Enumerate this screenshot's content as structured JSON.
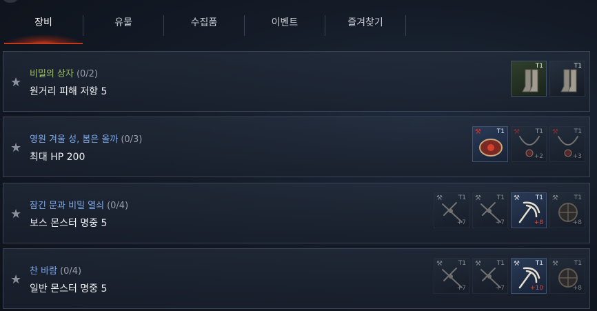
{
  "tabs": [
    {
      "label": "장비",
      "active": true
    },
    {
      "label": "유물",
      "active": false
    },
    {
      "label": "수집품",
      "active": false
    },
    {
      "label": "이벤트",
      "active": false
    },
    {
      "label": "즐겨찾기",
      "active": false
    }
  ],
  "colors": {
    "accent": "#c23a1c",
    "name_green": "#9fc26a",
    "name_blue": "#7fa8e6"
  },
  "collections": [
    {
      "name": "비밀의 상자",
      "progress": "(0/2)",
      "stat": "원거리 피해 저항  5",
      "name_color": "green",
      "items": [
        {
          "icon": "boots-icon",
          "tier": "T1",
          "plus": "",
          "craft": false,
          "style": "green"
        },
        {
          "icon": "boots-icon",
          "tier": "T1",
          "plus": "",
          "craft": false,
          "style": "dark"
        }
      ]
    },
    {
      "name": "영원 겨울 성, 봄은 올까",
      "progress": "(0/3)",
      "stat": "최대 HP  200",
      "name_color": "blue",
      "items": [
        {
          "icon": "gauntlet-icon",
          "tier": "T1",
          "plus": "",
          "craft": true,
          "style": "blue"
        },
        {
          "icon": "necklace-icon",
          "tier": "T1",
          "plus": "+2",
          "craft": true,
          "style": "dark-dim"
        },
        {
          "icon": "necklace-icon",
          "tier": "T1",
          "plus": "+3",
          "craft": true,
          "style": "dark-dim"
        }
      ]
    },
    {
      "name": "잠긴 문과 비밀 열쇠",
      "progress": "(0/4)",
      "stat": "보스 몬스터 명중  5",
      "name_color": "blue",
      "items": [
        {
          "icon": "crossbow-icon",
          "tier": "T1",
          "plus": "+7",
          "craft": true,
          "style": "dark-dim"
        },
        {
          "icon": "crossbow-icon",
          "tier": "T1",
          "plus": "+7",
          "craft": true,
          "style": "dark-dim"
        },
        {
          "icon": "claw-weapon-icon",
          "tier": "T1",
          "plus": "+8",
          "craft": true,
          "style": "blue"
        },
        {
          "icon": "orb-icon",
          "tier": "T1",
          "plus": "+8",
          "craft": true,
          "style": "dark-dim"
        }
      ]
    },
    {
      "name": "찬 바람",
      "progress": "(0/4)",
      "stat": "일반 몬스터 명중  5",
      "name_color": "blue",
      "items": [
        {
          "icon": "crossbow-icon",
          "tier": "T1",
          "plus": "+7",
          "craft": true,
          "style": "dark-dim"
        },
        {
          "icon": "crossbow-icon",
          "tier": "T1",
          "plus": "+7",
          "craft": true,
          "style": "dark-dim"
        },
        {
          "icon": "claw-weapon-icon",
          "tier": "T1",
          "plus": "+10",
          "craft": true,
          "style": "blue"
        },
        {
          "icon": "orb-icon",
          "tier": "T1",
          "plus": "+8",
          "craft": true,
          "style": "dark-dim"
        }
      ]
    }
  ]
}
